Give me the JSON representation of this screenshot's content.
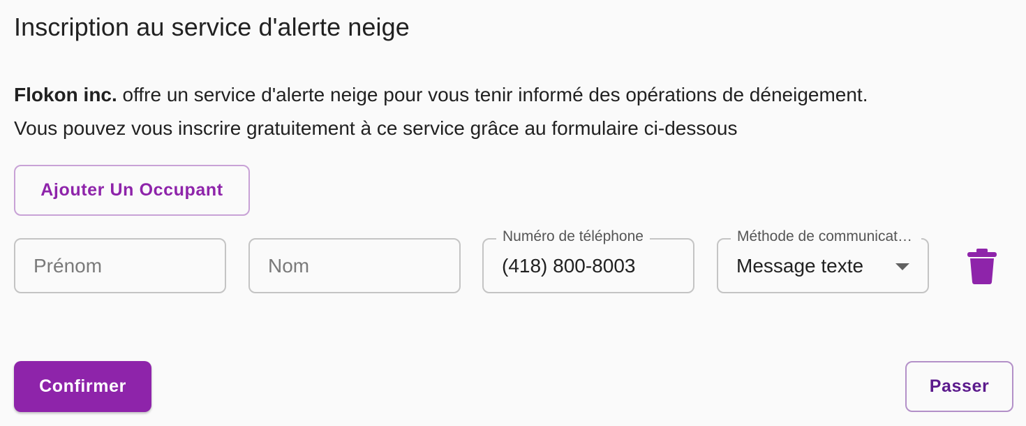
{
  "page": {
    "title": "Inscription au service d'alerte neige"
  },
  "intro": {
    "company": "Flokon inc.",
    "line1_rest": " offre un service d'alerte neige pour vous tenir informé des opérations de déneigement.",
    "line2": "Vous pouvez vous inscrire gratuitement à ce service grâce au formulaire ci-dessous"
  },
  "actions": {
    "add_occupant_label": "Ajouter Un Occupant",
    "confirm_label": "Confirmer",
    "skip_label": "Passer"
  },
  "occupant_row": {
    "first_name": {
      "placeholder": "Prénom",
      "value": ""
    },
    "last_name": {
      "placeholder": "Nom",
      "value": ""
    },
    "phone": {
      "label": "Numéro de téléphone",
      "value": "(418) 800-8003"
    },
    "method": {
      "label": "Méthode de communication",
      "value": "Message texte"
    },
    "delete_icon": "trash-icon"
  },
  "colors": {
    "accent": "#8e24aa",
    "accent_dark": "#5b1a8c",
    "outline": "#c4c4c4",
    "background": "#fafafa"
  }
}
